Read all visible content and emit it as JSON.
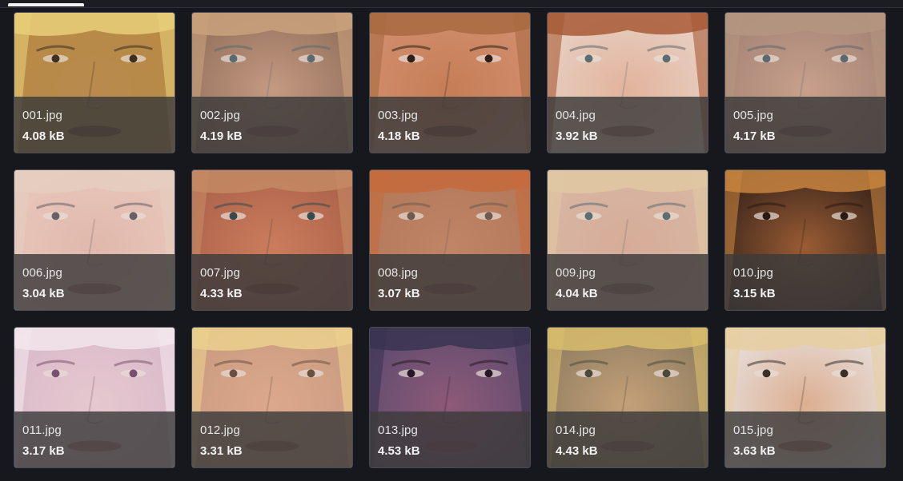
{
  "files": [
    {
      "name": "001.jpg",
      "size": "4.08 kB",
      "skin": "#b88a4e",
      "hair": "#e8cf7a",
      "bg": "#b98a44",
      "eye": "#3c3020",
      "lip": "#6e3a2e"
    },
    {
      "name": "002.jpg",
      "size": "4.19 kB",
      "skin": "#c49a82",
      "hair": "#c9a27c",
      "bg": "#8f6c58",
      "eye": "#5a6a70",
      "lip": "#8a4e4a"
    },
    {
      "name": "003.jpg",
      "size": "4.18 kB",
      "skin": "#c57d56",
      "hair": "#a86a42",
      "bg": "#d39070",
      "eye": "#2e2018",
      "lip": "#7a3e2e"
    },
    {
      "name": "004.jpg",
      "size": "3.92 kB",
      "skin": "#e2b39c",
      "hair": "#a85a36",
      "bg": "#e8d4c8",
      "eye": "#5d6c6e",
      "lip": "#9a5a52"
    },
    {
      "name": "005.jpg",
      "size": "4.17 kB",
      "skin": "#c8a08c",
      "hair": "#b49680",
      "bg": "#a08072",
      "eye": "#5c6a6e",
      "lip": "#8e4e52"
    },
    {
      "name": "006.jpg",
      "size": "3.04 kB",
      "skin": "#e0b8ac",
      "hair": "#e4cec0",
      "bg": "#eac8bc",
      "eye": "#6a6068",
      "lip": "#a46a6a"
    },
    {
      "name": "007.jpg",
      "size": "4.33 kB",
      "skin": "#cb7c5c",
      "hair": "#c48a64",
      "bg": "#a86048",
      "eye": "#3a4a4c",
      "lip": "#8a3c38"
    },
    {
      "name": "008.jpg",
      "size": "3.07 kB",
      "skin": "#c08466",
      "hair": "#c66a3c",
      "bg": "#b07858",
      "eye": "#6e5a50",
      "lip": "#8a4a40"
    },
    {
      "name": "009.jpg",
      "size": "4.04 kB",
      "skin": "#d6ac98",
      "hair": "#e0c8a2",
      "bg": "#d8b8a4",
      "eye": "#5c6e72",
      "lip": "#946060"
    },
    {
      "name": "010.jpg",
      "size": "3.15 kB",
      "skin": "#9a5c34",
      "hair": "#c8843e",
      "bg": "#2e1e18",
      "eye": "#2a1a14",
      "lip": "#6a3a2a"
    },
    {
      "name": "011.jpg",
      "size": "3.17 kB",
      "skin": "#e6c8d0",
      "hair": "#f2e6ec",
      "bg": "#d8b8c8",
      "eye": "#7a5070",
      "lip": "#b06a7a"
    },
    {
      "name": "012.jpg",
      "size": "3.31 kB",
      "skin": "#dca88c",
      "hair": "#ecd08e",
      "bg": "#c89a80",
      "eye": "#6a5040",
      "lip": "#a06050"
    },
    {
      "name": "013.jpg",
      "size": "4.53 kB",
      "skin": "#8e5a78",
      "hair": "#3a3450",
      "bg": "#5a4a6e",
      "eye": "#261826",
      "lip": "#8a3c58"
    },
    {
      "name": "014.jpg",
      "size": "4.43 kB",
      "skin": "#c4a078",
      "hair": "#d8bc6c",
      "bg": "#8a7a5e",
      "eye": "#4a4a3c",
      "lip": "#8a5a4c"
    },
    {
      "name": "015.jpg",
      "size": "3.63 kB",
      "skin": "#dcae90",
      "hair": "#e6cea0",
      "bg": "#e8e4e4",
      "eye": "#3a3028",
      "lip": "#a46058"
    }
  ]
}
